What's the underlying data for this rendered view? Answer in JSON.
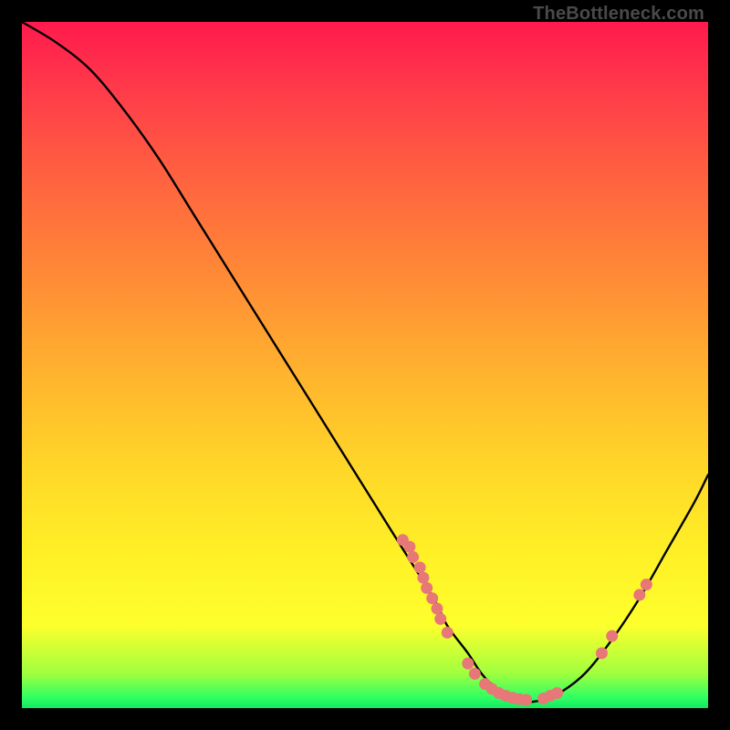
{
  "watermark": "TheBottleneck.com",
  "chart_data": {
    "type": "line",
    "title": "",
    "xlabel": "",
    "ylabel": "",
    "xlim": [
      0,
      100
    ],
    "ylim": [
      0,
      100
    ],
    "grid": false,
    "legend": false,
    "series": [
      {
        "name": "curve",
        "x": [
          0,
          5,
          10,
          15,
          20,
          25,
          30,
          35,
          40,
          45,
          50,
          55,
          60,
          62,
          65,
          67,
          69,
          71,
          73,
          75,
          78,
          82,
          86,
          90,
          94,
          98,
          100
        ],
        "y": [
          100,
          97,
          93,
          87,
          80,
          72,
          64,
          56,
          48,
          40,
          32,
          24,
          16,
          12,
          8,
          5,
          3,
          2,
          1,
          1,
          2,
          5,
          10,
          16,
          23,
          30,
          34
        ],
        "color": "#000000"
      }
    ],
    "markers": [
      {
        "x": 55.5,
        "y": 24.5
      },
      {
        "x": 56.5,
        "y": 23.5
      },
      {
        "x": 57.0,
        "y": 22.0
      },
      {
        "x": 58.0,
        "y": 20.5
      },
      {
        "x": 58.5,
        "y": 19.0
      },
      {
        "x": 59.0,
        "y": 17.5
      },
      {
        "x": 59.8,
        "y": 16.0
      },
      {
        "x": 60.5,
        "y": 14.5
      },
      {
        "x": 61.0,
        "y": 13.0
      },
      {
        "x": 62.0,
        "y": 11.0
      },
      {
        "x": 65.0,
        "y": 6.5
      },
      {
        "x": 66.0,
        "y": 5.0
      },
      {
        "x": 67.5,
        "y": 3.5
      },
      {
        "x": 68.5,
        "y": 2.8
      },
      {
        "x": 69.5,
        "y": 2.2
      },
      {
        "x": 70.5,
        "y": 1.8
      },
      {
        "x": 71.5,
        "y": 1.5
      },
      {
        "x": 72.5,
        "y": 1.3
      },
      {
        "x": 73.5,
        "y": 1.2
      },
      {
        "x": 76.0,
        "y": 1.4
      },
      {
        "x": 77.0,
        "y": 1.8
      },
      {
        "x": 78.0,
        "y": 2.2
      },
      {
        "x": 84.5,
        "y": 8.0
      },
      {
        "x": 86.0,
        "y": 10.5
      },
      {
        "x": 90.0,
        "y": 16.5
      },
      {
        "x": 91.0,
        "y": 18.0
      }
    ],
    "marker_color": "#e87777"
  }
}
